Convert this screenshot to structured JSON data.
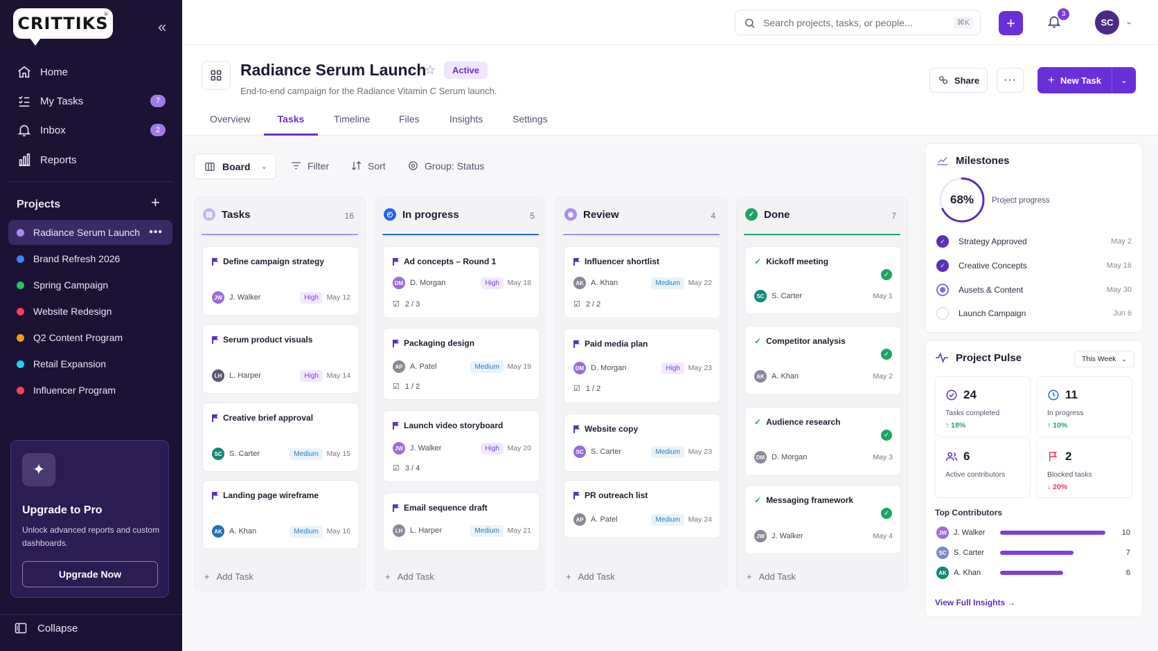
{
  "sidebar": {
    "logo": "CRITTIKS",
    "logo_mark": "®",
    "nav": [
      {
        "label": "Home",
        "icon": "home-icon"
      },
      {
        "label": "My Tasks",
        "icon": "tasks-icon",
        "badge": "7"
      },
      {
        "label": "Inbox",
        "icon": "bell-icon",
        "badge": "2"
      },
      {
        "label": "Reports",
        "icon": "bar-chart-icon"
      }
    ],
    "projects_label": "Projects",
    "projects": [
      {
        "label": "Radiance Serum Launch",
        "color": "#a98af0",
        "active": true
      },
      {
        "label": "Brand Refresh 2026",
        "color": "#3b82f6"
      },
      {
        "label": "Spring Campaign",
        "color": "#22c55e"
      },
      {
        "label": "Website Redesign",
        "color": "#f43f5e"
      },
      {
        "label": "Q2 Content Program",
        "color": "#f59e0b"
      },
      {
        "label": "Retail Expansion",
        "color": "#22d3ee"
      },
      {
        "label": "Influencer Program",
        "color": "#f43f5e"
      }
    ],
    "upgrade": {
      "title": "Upgrade to Pro",
      "text": "Unlock advanced reports and custom dashboards.",
      "button": "Upgrade Now"
    },
    "collapse_label": "Collapse"
  },
  "topbar": {
    "search_placeholder": "Search projects, tasks, or people...",
    "search_shortcut": "⌘K",
    "notifications": "3",
    "user_initials": "SC"
  },
  "header": {
    "title": "Radiance Serum Launch",
    "status": "Active",
    "subtitle": "End-to-end campaign for the Radiance Vitamin C Serum launch.",
    "share": "Share",
    "new_task": "New Task",
    "tabs": [
      "Overview",
      "Tasks",
      "Timeline",
      "Files",
      "Insights",
      "Settings"
    ],
    "active_tab": "Tasks"
  },
  "toolbar": {
    "view": "Board",
    "filter": "Filter",
    "sort": "Sort",
    "group": "Group: Status"
  },
  "add_task_label": "Add Task",
  "columns": [
    {
      "name": "Tasks",
      "count": "16",
      "color": "#a78bfa",
      "cards": [
        {
          "title": "Define campaign strategy",
          "assignee": "J. Walker",
          "initials": "JW",
          "av_color": "#9b6bdc",
          "priority": "High",
          "date": "May 12"
        },
        {
          "title": "Serum product visuals",
          "assignee": "L. Harper",
          "initials": "LH",
          "av_color": "#5d5b72",
          "priority": "High",
          "date": "May 14"
        },
        {
          "title": "Creative brief approval",
          "assignee": "S. Carter",
          "initials": "SC",
          "av_color": "#128a73",
          "priority": "Medium",
          "date": "May 15"
        },
        {
          "title": "Landing page wireframe",
          "assignee": "A. Khan",
          "initials": "AK",
          "av_color": "#1f6fb5",
          "priority": "Medium",
          "date": "May 16"
        }
      ]
    },
    {
      "name": "In progress",
      "count": "5",
      "color": "#2563eb",
      "cards": [
        {
          "title": "Ad concepts – Round 1",
          "assignee": "D. Morgan",
          "initials": "DM",
          "av_color": "#9b6bdc",
          "priority": "High",
          "date": "May 18",
          "subtasks": "2 / 3"
        },
        {
          "title": "Packaging design",
          "assignee": "A. Patel",
          "initials": "AP",
          "av_color": "#8a8797",
          "priority": "Medium",
          "date": "May 19",
          "subtasks": "1 / 2"
        },
        {
          "title": "Launch video storyboard",
          "assignee": "J. Walker",
          "initials": "JW",
          "av_color": "#9b6bdc",
          "priority": "High",
          "date": "May 20",
          "subtasks": "3 / 4"
        },
        {
          "title": "Email sequence draft",
          "assignee": "L. Harper",
          "initials": "LH",
          "av_color": "#8a8797",
          "priority": "Medium",
          "date": "May 21"
        }
      ]
    },
    {
      "name": "Review",
      "count": "4",
      "color": "#a78bfa",
      "cards": [
        {
          "title": "Influencer shortlist",
          "assignee": "A. Khan",
          "initials": "AK",
          "av_color": "#8a8797",
          "priority": "Medium",
          "date": "May 22",
          "subtasks": "2 / 2"
        },
        {
          "title": "Paid media plan",
          "assignee": "D. Morgan",
          "initials": "DM",
          "av_color": "#9b6bdc",
          "priority": "High",
          "date": "May 23",
          "subtasks": "1 / 2"
        },
        {
          "title": "Website copy",
          "assignee": "S. Carter",
          "initials": "SC",
          "av_color": "#9b6bdc",
          "priority": "Medium",
          "date": "May 23"
        },
        {
          "title": "PR outreach list",
          "assignee": "A. Patel",
          "initials": "AP",
          "av_color": "#8a8797",
          "priority": "Medium",
          "date": "May 24"
        }
      ]
    },
    {
      "name": "Done",
      "count": "7",
      "color": "#1aa563",
      "cards": [
        {
          "title": "Kickoff meeting",
          "assignee": "S. Carter",
          "initials": "SC",
          "av_color": "#128a73",
          "date": "May 1"
        },
        {
          "title": "Competitor analysis",
          "assignee": "A. Khan",
          "initials": "AK",
          "av_color": "#8a8797",
          "date": "May 2"
        },
        {
          "title": "Audience research",
          "assignee": "D. Morgan",
          "initials": "DM",
          "av_color": "#8a8797",
          "date": "May 3"
        },
        {
          "title": "Messaging framework",
          "assignee": "J. Walker",
          "initials": "JW",
          "av_color": "#8a8797",
          "date": "May 4"
        }
      ]
    }
  ],
  "milestones": {
    "title": "Milestones",
    "progress": "68%",
    "progress_value": 0.68,
    "progress_label": "Project progress",
    "items": [
      {
        "label": "Strategy Approved",
        "date": "May 2",
        "state": "done"
      },
      {
        "label": "Creative Concepts",
        "date": "May 16",
        "state": "done"
      },
      {
        "label": "Ausets & Content",
        "date": "May 30",
        "state": "current"
      },
      {
        "label": "Launch Campaign",
        "date": "Jun 6",
        "state": "todo"
      }
    ]
  },
  "pulse": {
    "title": "Project Pulse",
    "range": "This Week",
    "stats": [
      {
        "value": "24",
        "label": "Tasks completed",
        "change": "↑ 18%",
        "trend": "up",
        "icon": "check-circle-icon"
      },
      {
        "value": "11",
        "label": "In progress",
        "change": "↑ 10%",
        "trend": "up",
        "icon": "clock-icon"
      },
      {
        "value": "6",
        "label": "Active contributors",
        "icon": "users-icon"
      },
      {
        "value": "2",
        "label": "Blocked tasks",
        "change": "↓ 20%",
        "trend": "down",
        "icon": "flag-icon"
      }
    ],
    "contributors_title": "Top Contributors",
    "contributors": [
      {
        "name": "J. Walker",
        "initials": "JW",
        "value": 10,
        "color": "#9b6bdc"
      },
      {
        "name": "S. Carter",
        "initials": "SC",
        "value": 7,
        "color": "#7a89c9"
      },
      {
        "name": "A. Khan",
        "initials": "AK",
        "value": 6,
        "color": "#128a73"
      }
    ],
    "insights_link": "View Full Insights →"
  }
}
